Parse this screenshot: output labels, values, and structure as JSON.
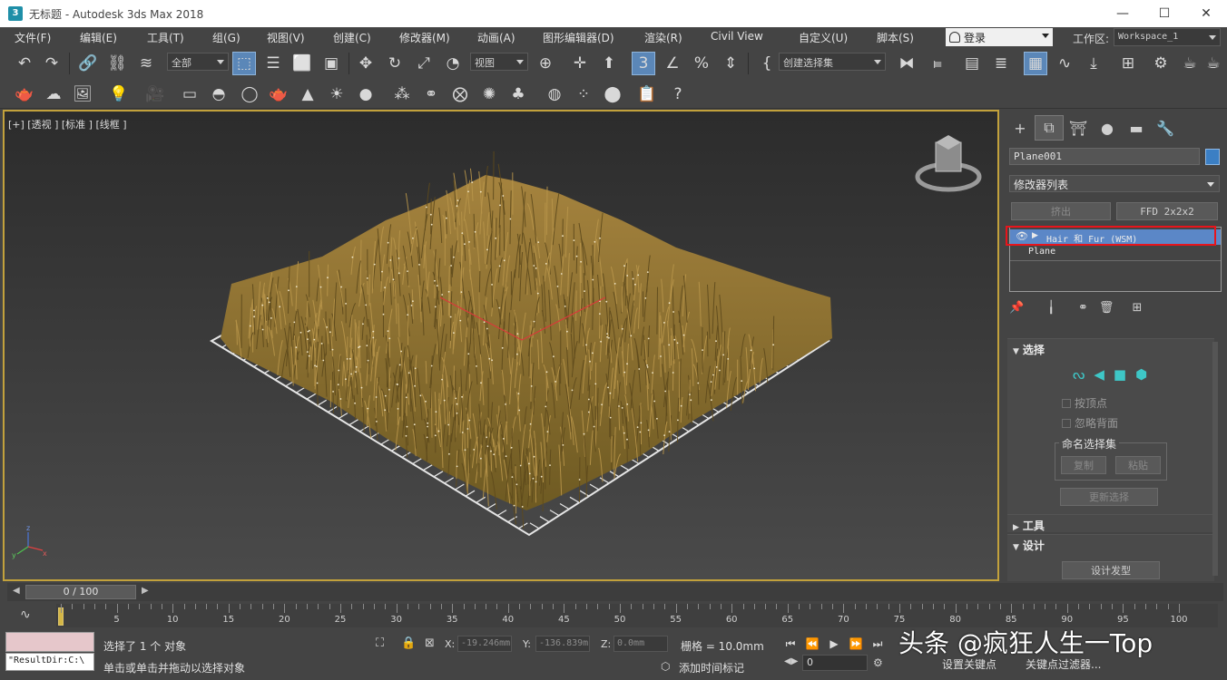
{
  "window": {
    "title": "无标题 - Autodesk 3ds Max 2018",
    "app_icon_letter": "3",
    "controls": {
      "minimize": "—",
      "maximize": "☐",
      "close": "✕"
    }
  },
  "menubar": {
    "items": [
      "文件(F)",
      "编辑(E)",
      "工具(T)",
      "组(G)",
      "视图(V)",
      "创建(C)",
      "修改器(M)",
      "动画(A)",
      "图形编辑器(D)",
      "渲染(R)",
      "Civil View",
      "自定义(U)",
      "脚本(S)"
    ],
    "login": "登录",
    "workspace_label": "工作区:",
    "workspace_value": "Workspace_1"
  },
  "toolbar": {
    "selection_filter": "全部",
    "ref_coord": "视图",
    "named_selection": "创建选择集"
  },
  "viewport": {
    "label": "[+] [透视 ] [标准 ] [线框 ]"
  },
  "command_panel": {
    "object_name": "Plane001",
    "object_color": "#3b7fc4",
    "modifier_list": "修改器列表",
    "btn_extrude": "挤出",
    "btn_ffd": "FFD 2x2x2",
    "stack": [
      {
        "label": "Hair 和 Fur (WSM)"
      },
      {
        "label": "Plane"
      }
    ],
    "rollouts": {
      "selection": {
        "title": "选择",
        "by_vertex": "按顶点",
        "ignore_backfacing": "忽略背面",
        "named_sets": "命名选择集",
        "copy": "复制",
        "paste": "粘贴",
        "update_selection": "更新选择"
      },
      "tools": {
        "title": "工具"
      },
      "design": {
        "title": "设计",
        "design_hair": "设计发型"
      }
    }
  },
  "timeline": {
    "frame_display": "0 / 100",
    "ticks": [
      "5",
      "10",
      "15",
      "20",
      "25",
      "30",
      "35",
      "40",
      "45",
      "50",
      "55",
      "60",
      "65",
      "70",
      "75",
      "80",
      "85",
      "90",
      "95",
      "100"
    ]
  },
  "status": {
    "listener_text": "\"ResultDir:C:\\",
    "selected": "选择了 1 个 对象",
    "prompt": "单击或单击并拖动以选择对象",
    "x_label": "X:",
    "x_value": "-19.246mm",
    "y_label": "Y:",
    "y_value": "-136.839m",
    "z_label": "Z:",
    "z_value": "0.0mm",
    "grid": "栅格 = 10.0mm",
    "add_time_tag": "添加时间标记",
    "set_key": "设置关键点",
    "key_filters": "关键点过滤器...",
    "current_frame": "0"
  },
  "watermark": "头条 @疯狂人生一Top"
}
